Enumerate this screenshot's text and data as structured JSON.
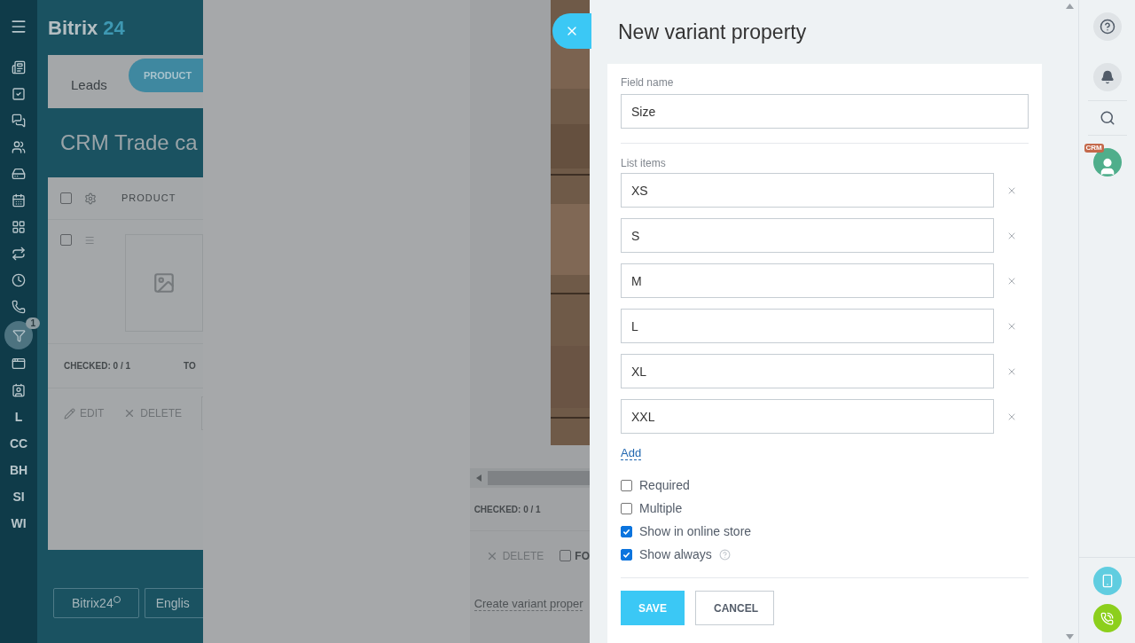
{
  "app": {
    "logo_name": "Bitrix",
    "logo_number": "24",
    "sidebar_badge": "1",
    "sidebar_letters": [
      "L",
      "CC",
      "BH",
      "SI",
      "WI"
    ],
    "tabs": [
      {
        "label": "Leads",
        "selected": false
      },
      {
        "label": "PRODUCT",
        "selected": true
      }
    ],
    "page_title": "CRM Trade ca",
    "table": {
      "header_checked": false,
      "row_checked": false,
      "column": "PRODUCT",
      "checked": "CHECKED: 0 / 1",
      "total_label": "TO",
      "actions": [
        "EDIT",
        "DELETE"
      ]
    },
    "footer_buttons": [
      "Bitrix24",
      "Englis"
    ]
  },
  "product_panel": {
    "checked": "CHECKED: 0 / 1",
    "delete": "DELETE",
    "checkbox_label": "FO",
    "checkbox_checked": false,
    "link": "Create variant proper"
  },
  "form": {
    "title": "New variant property",
    "field_label": "Field name",
    "field_value": "Size",
    "list_label": "List items",
    "items": [
      "XS",
      "S",
      "M",
      "L",
      "XL",
      "XXL"
    ],
    "add": "Add",
    "options": [
      {
        "label": "Required",
        "checked": false,
        "hint": false
      },
      {
        "label": "Multiple",
        "checked": false,
        "hint": false
      },
      {
        "label": "Show in online store",
        "checked": true,
        "hint": false
      },
      {
        "label": "Show always",
        "checked": true,
        "hint": true
      }
    ],
    "buttons": [
      "SAVE",
      "CANCEL"
    ]
  },
  "right_bar": {
    "crm_badge": "CRM"
  }
}
